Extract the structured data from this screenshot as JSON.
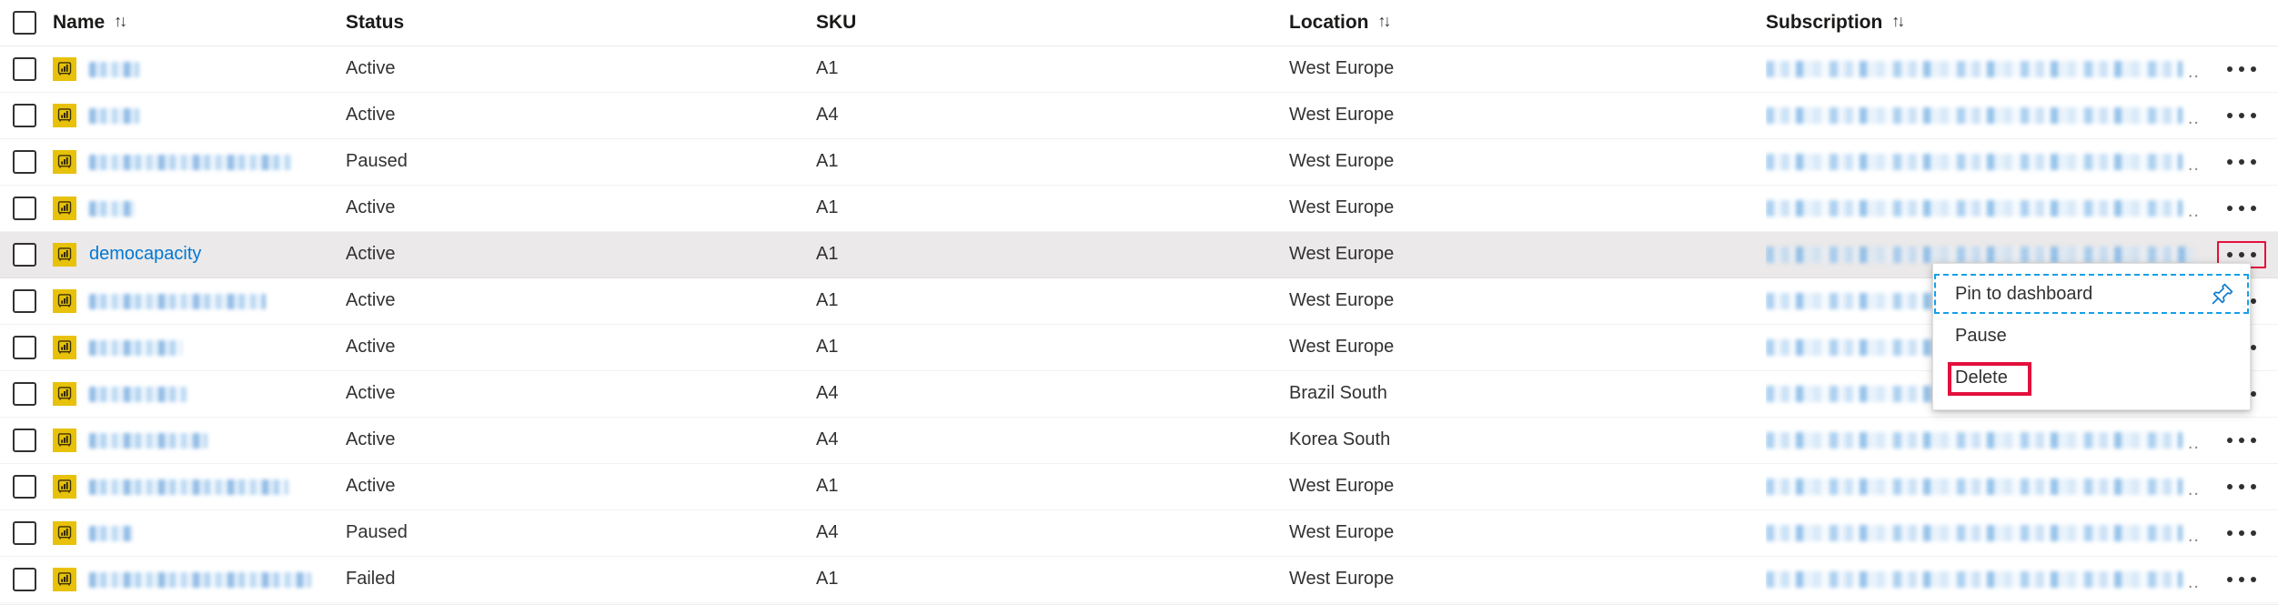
{
  "table": {
    "columns": [
      {
        "key": "select",
        "label": "",
        "sortable": false,
        "icon": "select-all-checkbox"
      },
      {
        "key": "name",
        "label": "Name",
        "sortable": true,
        "sort_glyph": "↑↓"
      },
      {
        "key": "status",
        "label": "Status",
        "sortable": false
      },
      {
        "key": "sku",
        "label": "SKU",
        "sortable": false
      },
      {
        "key": "location",
        "label": "Location",
        "sortable": true,
        "sort_glyph": "↑↓"
      },
      {
        "key": "subscription",
        "label": "Subscription",
        "sortable": true,
        "sort_glyph": "↑↓"
      },
      {
        "key": "actions",
        "label": "",
        "sortable": false
      }
    ],
    "rows": [
      {
        "name": "a1cap",
        "name_redacted": true,
        "resource_icon": "power-bi-capacity-icon",
        "status": "Active",
        "sku": "A1",
        "location": "West Europe",
        "subscription_redacted": true,
        "subscription_truncated": "..",
        "selected": false
      },
      {
        "name": "a4cap",
        "name_redacted": true,
        "resource_icon": "power-bi-capacity-icon",
        "status": "Active",
        "sku": "A4",
        "location": "West Europe",
        "subscription_redacted": true,
        "subscription_truncated": "..",
        "selected": false
      },
      {
        "name": "capacitycreatedontdelete",
        "name_redacted": true,
        "resource_icon": "power-bi-capacity-icon",
        "status": "Paused",
        "sku": "A1",
        "location": "West Europe",
        "subscription_redacted": true,
        "subscription_truncated": "..",
        "selected": false
      },
      {
        "name": "demo",
        "name_redacted": true,
        "resource_icon": "power-bi-capacity-icon",
        "status": "Active",
        "sku": "A1",
        "location": "West Europe",
        "subscription_redacted": true,
        "subscription_truncated": "..",
        "selected": false
      },
      {
        "name": "democapacity",
        "name_redacted": false,
        "resource_icon": "power-bi-capacity-icon",
        "status": "Active",
        "sku": "A1",
        "location": "West Europe",
        "subscription_redacted": true,
        "subscription_truncated": "",
        "selected": true
      },
      {
        "name": "e2ecapturedontdelete",
        "name_redacted": true,
        "resource_icon": "power-bi-capacity-icon",
        "status": "Active",
        "sku": "A1",
        "location": "West Europe",
        "subscription_redacted": true,
        "subscription_truncated": "..",
        "selected": false
      },
      {
        "name": "gomezcaps",
        "name_redacted": true,
        "resource_icon": "power-bi-capacity-icon",
        "status": "Active",
        "sku": "A1",
        "location": "West Europe",
        "subscription_redacted": true,
        "subscription_truncated": "..",
        "selected": false
      },
      {
        "name": "mycapbrazil",
        "name_redacted": true,
        "resource_icon": "power-bi-capacity-icon",
        "status": "Active",
        "sku": "A4",
        "location": "Brazil South",
        "subscription_redacted": true,
        "subscription_truncated": "..",
        "selected": false
      },
      {
        "name": "mykoreaconfig",
        "name_redacted": true,
        "resource_icon": "power-bi-capacity-icon",
        "status": "Active",
        "sku": "A4",
        "location": "Korea South",
        "subscription_redacted": true,
        "subscription_truncated": "..",
        "selected": false
      },
      {
        "name": "pbiautomationdontdelete",
        "name_redacted": true,
        "resource_icon": "power-bi-capacity-icon",
        "status": "Active",
        "sku": "A1",
        "location": "West Europe",
        "subscription_redacted": true,
        "subscription_truncated": "..",
        "selected": false
      },
      {
        "name": "latest",
        "name_redacted": true,
        "resource_icon": "power-bi-capacity-icon",
        "status": "Paused",
        "sku": "A4",
        "location": "West Europe",
        "subscription_redacted": true,
        "subscription_truncated": "..",
        "selected": false
      },
      {
        "name": "testcapacity21ca7f45e084a",
        "name_redacted": true,
        "resource_icon": "power-bi-capacity-icon",
        "status": "Failed",
        "sku": "A1",
        "location": "West Europe",
        "subscription_redacted": true,
        "subscription_truncated": "..",
        "selected": false
      }
    ],
    "row_action_icon": "ellipsis-horizontal-icon",
    "row_action_label": "More options"
  },
  "context_menu": {
    "anchor_row_index": 4,
    "items": [
      {
        "label": "Pin to dashboard",
        "icon": "pin-icon",
        "focused": true,
        "annotated": false
      },
      {
        "label": "Pause",
        "icon": "",
        "focused": false,
        "annotated": false
      },
      {
        "label": "Delete",
        "icon": "",
        "focused": false,
        "annotated": true
      }
    ]
  },
  "annotations": {
    "box_color": "#e3103c",
    "targets": [
      "row-more-button",
      "menu-item-delete"
    ]
  },
  "colors": {
    "link": "#0078d4",
    "text": "#323130",
    "header_text": "#1b1a19",
    "row_border": "#f3f2f1",
    "selected_row_bg": "#ebe9e9",
    "power_bi_icon_bg": "#e8c20a",
    "focus_outline": "#16a0e8",
    "annotation_red": "#e3103c"
  }
}
